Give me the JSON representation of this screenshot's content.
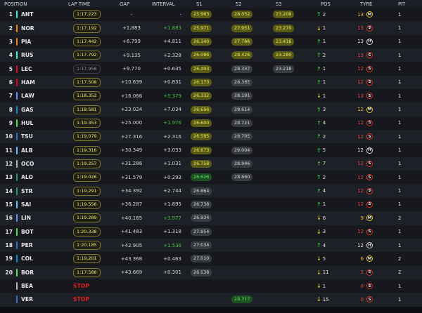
{
  "header": {
    "position": "POSITION",
    "lap_time": "LAP TIME",
    "gap": "GAP",
    "interval": "INTERVAL",
    "s1": "S1",
    "s2": "S2",
    "s3": "S3",
    "pos": "POS",
    "tyre": "TYRE",
    "pit": "PIT"
  },
  "team_colors": {
    "mercedes": "#27f4d2",
    "mclaren": "#ff8000",
    "ferrari": "#e8002d",
    "redbull": "#3671c6",
    "astonmartin": "#229971",
    "alpine": "#0093cc",
    "williams": "#64c4ff",
    "racingbulls": "#6692ff",
    "haas": "#b6babd",
    "sauber": "#52e252"
  },
  "rows": [
    {
      "num": "1",
      "driver": "ANT",
      "team": "mercedes",
      "lap": "1:17.223",
      "lapStyle": "lapy",
      "gap": "-",
      "int": "-",
      "intColor": "w",
      "s1": "25.963",
      "s1c": "yellow",
      "s2": "28.052",
      "s2c": "yellow",
      "s3": "23.208",
      "s3c": "yellow",
      "dir": "up",
      "pchg": "2",
      "tyAge": "13",
      "tyAgeC": "yel",
      "tyre": "M",
      "pit": "1"
    },
    {
      "num": "2",
      "driver": "NOR",
      "team": "mclaren",
      "lap": "1:17.192",
      "lapStyle": "lapy",
      "gap": "+1.883",
      "int": "+1.883",
      "intColor": "g",
      "s1": "25.971",
      "s1c": "yellow",
      "s2": "27.951",
      "s2c": "yellow",
      "s3": "23.270",
      "s3c": "yellow",
      "dir": "down",
      "pchg": "1",
      "tyAge": "13",
      "tyAgeC": "red",
      "tyre": "S",
      "pit": "1"
    },
    {
      "num": "3",
      "driver": "PIA",
      "team": "mclaren",
      "lap": "1:17.442",
      "lapStyle": "lapy",
      "gap": "+6.799",
      "int": "+4.811",
      "intColor": "w",
      "s1": "26.140",
      "s1c": "yellow",
      "s2": "27.786",
      "s2c": "yellow",
      "s3": "23.416",
      "s3c": "yellow",
      "dir": "up",
      "pchg": "1",
      "tyAge": "13",
      "tyAgeC": "wht",
      "tyre": "H",
      "pit": "1"
    },
    {
      "num": "4",
      "driver": "RUS",
      "team": "mercedes",
      "lap": "1:17.792",
      "lapStyle": "lapy",
      "gap": "+9.135",
      "int": "+2.328",
      "intColor": "w",
      "s1": "26.086",
      "s1c": "yellow",
      "s2": "28.426",
      "s2c": "yellow",
      "s3": "23.280",
      "s3c": "yellow",
      "dir": "up",
      "pchg": "2",
      "tyAge": "13",
      "tyAgeC": "red",
      "tyre": "S",
      "pit": "1"
    },
    {
      "num": "5",
      "driver": "LEC",
      "team": "ferrari",
      "lap": "1:17.958",
      "lapStyle": "lapg",
      "gap": "+9.770",
      "int": "+0.635",
      "intColor": "w",
      "s1": "26.403",
      "s1c": "yellow",
      "s2": "28.337",
      "s2c": "grey",
      "s3": "23.218",
      "s3c": "grey",
      "dir": "up",
      "pchg": "1",
      "tyAge": "12",
      "tyAgeC": "red",
      "tyre": "S",
      "pit": "1"
    },
    {
      "num": "6",
      "driver": "HAM",
      "team": "ferrari",
      "lap": "1:17.508",
      "lapStyle": "lapy",
      "gap": "+10.639",
      "int": "+0.831",
      "intColor": "w",
      "s1": "26.173",
      "s1c": "yellow",
      "s2": "28.365",
      "s2c": "grey",
      "s3": "",
      "s3c": "",
      "dir": "up",
      "pchg": "1",
      "tyAge": "12",
      "tyAgeC": "red",
      "tyre": "S",
      "pit": "1"
    },
    {
      "num": "7",
      "driver": "LAW",
      "team": "racingbulls",
      "lap": "1:18.352",
      "lapStyle": "lapy",
      "gap": "+16.066",
      "int": "+5.379",
      "intColor": "g",
      "s1": "26.332",
      "s1c": "yellow",
      "s2": "28.191",
      "s2c": "grey",
      "s3": "",
      "s3c": "",
      "dir": "down",
      "pchg": "1",
      "tyAge": "13",
      "tyAgeC": "red",
      "tyre": "S",
      "pit": "1"
    },
    {
      "num": "8",
      "driver": "GAS",
      "team": "alpine",
      "lap": "1:18.581",
      "lapStyle": "lapy",
      "gap": "+23.024",
      "int": "+7.034",
      "intColor": "w",
      "s1": "26.696",
      "s1c": "yellow",
      "s2": "28.614",
      "s2c": "grey",
      "s3": "",
      "s3c": "",
      "dir": "up",
      "pchg": "3",
      "tyAge": "12",
      "tyAgeC": "yel",
      "tyre": "M",
      "pit": "1"
    },
    {
      "num": "9",
      "driver": "HUL",
      "team": "sauber",
      "lap": "1:19.353",
      "lapStyle": "lapy",
      "gap": "+25.000",
      "int": "+1.976",
      "intColor": "g",
      "s1": "26.600",
      "s1c": "yellow",
      "s2": "28.721",
      "s2c": "grey",
      "s3": "",
      "s3c": "",
      "dir": "up",
      "pchg": "4",
      "tyAge": "12",
      "tyAgeC": "red",
      "tyre": "S",
      "pit": "1"
    },
    {
      "num": "10",
      "driver": "TSU",
      "team": "redbull",
      "lap": "1:19.079",
      "lapStyle": "lapy",
      "gap": "+27.316",
      "int": "+2.316",
      "intColor": "w",
      "s1": "26.595",
      "s1c": "yellow",
      "s2": "28.705",
      "s2c": "grey",
      "s3": "",
      "s3c": "",
      "dir": "up",
      "pchg": "2",
      "tyAge": "12",
      "tyAgeC": "red",
      "tyre": "S",
      "pit": "1"
    },
    {
      "num": "11",
      "driver": "ALB",
      "team": "williams",
      "lap": "1:19.316",
      "lapStyle": "lapy",
      "gap": "+30.349",
      "int": "+3.033",
      "intColor": "w",
      "s1": "26.673",
      "s1c": "yellow",
      "s2": "29.004",
      "s2c": "grey",
      "s3": "",
      "s3c": "",
      "dir": "up",
      "pchg": "5",
      "tyAge": "12",
      "tyAgeC": "wht",
      "tyre": "H",
      "pit": "1"
    },
    {
      "num": "12",
      "driver": "OCO",
      "team": "haas",
      "lap": "1:19.257",
      "lapStyle": "lapy",
      "gap": "+31.286",
      "int": "+1.031",
      "intColor": "w",
      "s1": "26.758",
      "s1c": "yellow",
      "s2": "28.946",
      "s2c": "grey",
      "s3": "",
      "s3c": "",
      "dir": "up",
      "pchg": "7",
      "tyAge": "12",
      "tyAgeC": "red",
      "tyre": "S",
      "pit": "1"
    },
    {
      "num": "13",
      "driver": "ALO",
      "team": "astonmartin",
      "lap": "1:19.026",
      "lapStyle": "lapy",
      "gap": "+31.579",
      "int": "+0.293",
      "intColor": "w",
      "s1": "26.626",
      "s1c": "green",
      "s2": "28.660",
      "s2c": "grey",
      "s3": "",
      "s3c": "",
      "dir": "up",
      "pchg": "2",
      "tyAge": "12",
      "tyAgeC": "red",
      "tyre": "S",
      "pit": "1"
    },
    {
      "num": "14",
      "driver": "STR",
      "team": "astonmartin",
      "lap": "1:19.291",
      "lapStyle": "lapy",
      "gap": "+34.392",
      "int": "+2.744",
      "intColor": "w",
      "s1": "26.864",
      "s1c": "grey",
      "s2": "",
      "s2c": "",
      "s3": "",
      "s3c": "",
      "dir": "up",
      "pchg": "4",
      "tyAge": "12",
      "tyAgeC": "red",
      "tyre": "S",
      "pit": "1"
    },
    {
      "num": "15",
      "driver": "SAI",
      "team": "williams",
      "lap": "1:19.556",
      "lapStyle": "lapy",
      "gap": "+36.287",
      "int": "+1.895",
      "intColor": "w",
      "s1": "26.738",
      "s1c": "grey",
      "s2": "",
      "s2c": "",
      "s3": "",
      "s3c": "",
      "dir": "up",
      "pchg": "1",
      "tyAge": "12",
      "tyAgeC": "red",
      "tyre": "S",
      "pit": "1"
    },
    {
      "num": "16",
      "driver": "LIN",
      "team": "racingbulls",
      "lap": "1:19.289",
      "lapStyle": "lapy",
      "gap": "+40.165",
      "int": "+3.977",
      "intColor": "g",
      "s1": "26.934",
      "s1c": "grey",
      "s2": "",
      "s2c": "",
      "s3": "",
      "s3c": "",
      "dir": "down",
      "pchg": "6",
      "tyAge": "9",
      "tyAgeC": "yel",
      "tyre": "M",
      "pit": "2"
    },
    {
      "num": "17",
      "driver": "BOT",
      "team": "sauber",
      "lap": "1:20.338",
      "lapStyle": "lapy",
      "gap": "+41.483",
      "int": "+1.318",
      "intColor": "w",
      "s1": "27.954",
      "s1c": "grey",
      "s2": "",
      "s2c": "",
      "s3": "",
      "s3c": "",
      "dir": "down",
      "pchg": "3",
      "tyAge": "12",
      "tyAgeC": "red",
      "tyre": "S",
      "pit": "1"
    },
    {
      "num": "18",
      "driver": "PER",
      "team": "redbull",
      "lap": "1:20.185",
      "lapStyle": "lapy",
      "gap": "+42.905",
      "int": "+1.536",
      "intColor": "g",
      "s1": "27.034",
      "s1c": "grey",
      "s2": "",
      "s2c": "",
      "s3": "",
      "s3c": "",
      "dir": "up",
      "pchg": "4",
      "tyAge": "12",
      "tyAgeC": "wht",
      "tyre": "H",
      "pit": "1"
    },
    {
      "num": "19",
      "driver": "COL",
      "team": "alpine",
      "lap": "1:19.201",
      "lapStyle": "lapy",
      "gap": "+43.368",
      "int": "+0.463",
      "intColor": "w",
      "s1": "27.010",
      "s1c": "grey",
      "s2": "",
      "s2c": "",
      "s3": "",
      "s3c": "",
      "dir": "down",
      "pchg": "5",
      "tyAge": "6",
      "tyAgeC": "yel",
      "tyre": "M",
      "pit": "2"
    },
    {
      "num": "20",
      "driver": "BOR",
      "team": "sauber",
      "lap": "1:17.588",
      "lapStyle": "lapy",
      "gap": "+43.669",
      "int": "+0.301",
      "intColor": "w",
      "s1": "26.538",
      "s1c": "grey",
      "s2": "",
      "s2c": "",
      "s3": "",
      "s3c": "",
      "dir": "down",
      "pchg": "11",
      "tyAge": "3",
      "tyAgeC": "red",
      "tyre": "S",
      "pit": "2"
    },
    {
      "num": "",
      "driver": "BEA",
      "team": "haas",
      "lap": "STOP",
      "lapStyle": "stop",
      "gap": "",
      "int": "",
      "intColor": "w",
      "s1": "",
      "s1c": "",
      "s2": "",
      "s2c": "",
      "s3": "",
      "s3c": "",
      "dir": "down",
      "pchg": "1",
      "tyAge": "0",
      "tyAgeC": "red",
      "tyre": "S",
      "pit": "1"
    },
    {
      "num": "",
      "driver": "VER",
      "team": "redbull",
      "lap": "STOP",
      "lapStyle": "stop",
      "gap": "",
      "int": "",
      "intColor": "w",
      "s1": "",
      "s1c": "",
      "s2": "28.317",
      "s2c": "green",
      "s3": "",
      "s3c": "",
      "dir": "down",
      "pchg": "15",
      "tyAge": "0",
      "tyAgeC": "red",
      "tyre": "S",
      "pit": "1"
    }
  ]
}
